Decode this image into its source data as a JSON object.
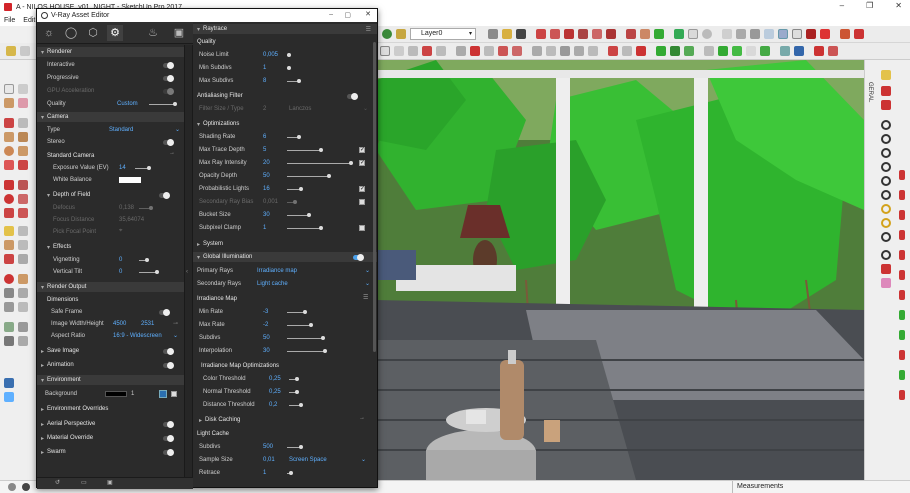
{
  "sketchup": {
    "title": "A - NILOS HOUSE_v01_NIGHT - SketchUp Pro 2017",
    "menu": [
      "File",
      "Edit"
    ],
    "layer": "Layer0",
    "measurements_label": "Measurements",
    "right_panel_tab": "GERAL",
    "window_buttons": [
      "–",
      "❐",
      "✕"
    ]
  },
  "vray": {
    "title": "V-Ray Asset Editor",
    "tabs": [
      "lights-icon",
      "geometry-icon",
      "materials-icon",
      "settings-icon",
      "teapot-render-icon",
      "frame-buffer-icon"
    ],
    "left": {
      "renderer": {
        "header": "Renderer",
        "interactive": "Interactive",
        "progressive": "Progressive",
        "gpu": "GPU Acceleration",
        "quality": "Quality",
        "quality_value": "Custom"
      },
      "camera": {
        "header": "Camera",
        "type": "Type",
        "type_value": "Standard",
        "stereo": "Stereo",
        "standard_camera": "Standard Camera",
        "exposure": "Exposure Value (EV)",
        "exposure_value": "14",
        "white_balance": "White Balance"
      },
      "dof": {
        "header": "Depth of Field",
        "defocus": "Defocus",
        "defocus_value": "0,138",
        "focus_distance": "Focus Distance",
        "focus_distance_value": "35,64074",
        "pick_focal": "Pick Focal Point"
      },
      "effects": {
        "header": "Effects",
        "vignetting": "Vignetting",
        "vignetting_value": "0",
        "vertical_tilt": "Vertical Tilt",
        "vertical_tilt_value": "0"
      },
      "render_output": {
        "header": "Render Output",
        "dimensions": "Dimensions",
        "safe_frame": "Safe Frame",
        "image_wh": "Image Width/Height",
        "width": "4500",
        "height": "2531",
        "aspect": "Aspect Ratio",
        "aspect_value": "16:9 - Widescreen"
      },
      "save_image": "Save Image",
      "animation": "Animation",
      "environment": {
        "header": "Environment",
        "background": "Background",
        "background_value": "1",
        "overrides": "Environment Overrides"
      },
      "aerial": "Aerial Perspective",
      "material_override": "Material Override",
      "swarm": "Swarm"
    },
    "right": {
      "raytrace": "Raytrace",
      "quality": {
        "header": "Quality",
        "noise_limit": "Noise Limit",
        "noise_limit_value": "0,005",
        "min_subdivs": "Min Subdivs",
        "min_subdivs_value": "1",
        "max_subdivs": "Max Subdivs",
        "max_subdivs_value": "8"
      },
      "antialiasing": {
        "header": "Antialiasing Filter",
        "filter": "Filter Size / Type",
        "filter_value": "2",
        "filter_type": "Lanczos"
      },
      "optimizations": {
        "header": "Optimizations",
        "shading_rate": "Shading Rate",
        "shading_rate_value": "6",
        "max_trace_depth": "Max Trace Depth",
        "max_trace_depth_value": "5",
        "max_ray_intensity": "Max Ray Intensity",
        "max_ray_intensity_value": "20",
        "opacity_depth": "Opacity Depth",
        "opacity_depth_value": "50",
        "probabilistic": "Probabilistic Lights",
        "probabilistic_value": "16",
        "secondary_bias": "Secondary Ray Bias",
        "secondary_bias_value": "0,001",
        "bucket_size": "Bucket Size",
        "bucket_size_value": "30",
        "subpixel_clamp": "Subpixel Clamp",
        "subpixel_clamp_value": "1"
      },
      "system": "System",
      "gi": {
        "header": "Global Illumination",
        "primary": "Primary Rays",
        "primary_value": "Irradiance map",
        "secondary": "Secondary Rays",
        "secondary_value": "Light cache"
      },
      "irradiance": {
        "header": "Irradiance Map",
        "min_rate": "Min Rate",
        "min_rate_value": "-3",
        "max_rate": "Max Rate",
        "max_rate_value": "-2",
        "subdivs": "Subdivs",
        "subdivs_value": "50",
        "interpolation": "Interpolation",
        "interpolation_value": "30",
        "opt_header": "Irradiance Map Optimizations",
        "color_threshold": "Color Threshold",
        "color_threshold_value": "0,25",
        "normal_threshold": "Normal Threshold",
        "normal_threshold_value": "0,25",
        "distance_threshold": "Distance Threshold",
        "distance_threshold_value": "0,2",
        "disk_caching": "Disk Caching"
      },
      "light_cache": {
        "header": "Light Cache",
        "subdivs": "Subdivs",
        "subdivs_value": "500",
        "sample_size": "Sample Size",
        "sample_size_value": "0,01",
        "sample_mode": "Screen Space",
        "retrace": "Retrace",
        "retrace_value": "1"
      }
    }
  }
}
